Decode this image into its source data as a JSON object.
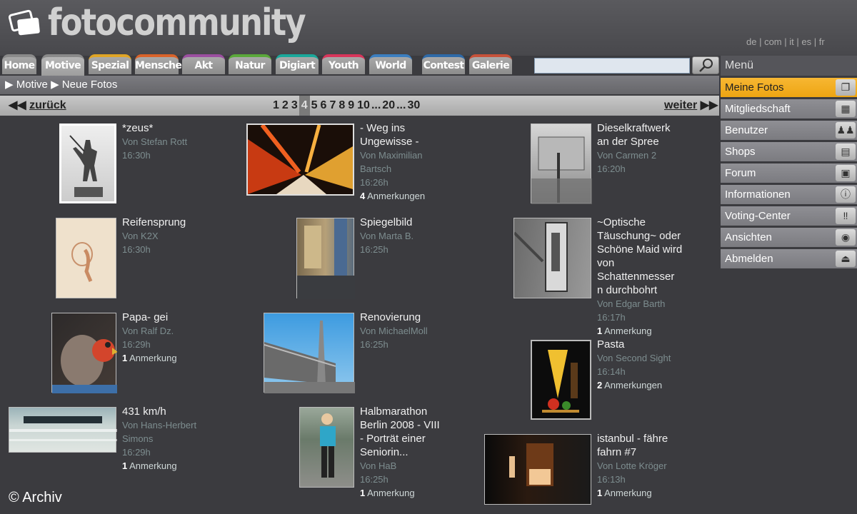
{
  "header": {
    "logo": "fotocommunity",
    "languages": [
      "de",
      "com",
      "it",
      "es",
      "fr"
    ],
    "lang_sep": " | "
  },
  "tabs": [
    "Home",
    "Motive",
    "Spezial",
    "Menschen",
    "Akt",
    "Natur",
    "Digiart",
    "Youth",
    "World",
    "Contest",
    "Galerie"
  ],
  "search": {
    "placeholder": "",
    "button_icon": "search-icon"
  },
  "breadcrumb": [
    "Motive",
    "Neue Fotos"
  ],
  "pager": {
    "prev": "zurück",
    "next": "weiter",
    "pages": [
      "1",
      "2",
      "3",
      "4",
      "5",
      "6",
      "7",
      "8",
      "9",
      "10",
      "...",
      "20",
      "...",
      "30"
    ],
    "current": "4"
  },
  "sidebar": {
    "title": "Menü",
    "items": [
      {
        "label": "Meine Fotos",
        "icon": "photos-icon"
      },
      {
        "label": "Mitgliedschaft",
        "icon": "calculator-icon"
      },
      {
        "label": "Benutzer",
        "icon": "users-icon"
      },
      {
        "label": "Shops",
        "icon": "cart-icon"
      },
      {
        "label": "Forum",
        "icon": "forum-icon"
      },
      {
        "label": "Informationen",
        "icon": "info-icon"
      },
      {
        "label": "Voting-Center",
        "icon": "exclamation-icon"
      },
      {
        "label": "Ansichten",
        "icon": "eye-icon"
      },
      {
        "label": "Abmelden",
        "icon": "eject-icon"
      }
    ]
  },
  "photos": [
    {
      "title": "*zeus*",
      "author": "Von Stefan Rott",
      "time": "16:30h",
      "notes": "",
      "notes_label": ""
    },
    {
      "title": "- Weg ins Ungewisse -",
      "author": "Von Maximilian Bartsch",
      "time": "16:26h",
      "notes": "4",
      "notes_label": " Anmerkungen"
    },
    {
      "title": "Dieselkraftwerk an der Spree",
      "author": "Von Carmen 2",
      "time": "16:20h",
      "notes": "",
      "notes_label": ""
    },
    {
      "title": "Reifensprung",
      "author": "Von K2X",
      "time": "16:30h",
      "notes": "",
      "notes_label": ""
    },
    {
      "title": "Spiegelbild",
      "author": "Von Marta B.",
      "time": "16:25h",
      "notes": "",
      "notes_label": ""
    },
    {
      "title": "~Optische Täuschung~ oder Schöne Maid wird von Schattenmesser n durchbohrt",
      "author": "Von Edgar Barth",
      "time": "16:17h",
      "notes": "1",
      "notes_label": " Anmerkung"
    },
    {
      "title": "Papa- gei",
      "author": "Von Ralf Dz.",
      "time": "16:29h",
      "notes": "1",
      "notes_label": " Anmerkung"
    },
    {
      "title": "Renovierung",
      "author": "Von MichaelMoll",
      "time": "16:25h",
      "notes": "",
      "notes_label": ""
    },
    {
      "title": "Pasta",
      "author": "Von Second Sight",
      "time": "16:14h",
      "notes": "2",
      "notes_label": " Anmerkungen"
    },
    {
      "title": "431 km/h",
      "author": "Von Hans-Herbert Simons",
      "time": "16:29h",
      "notes": "1",
      "notes_label": " Anmerkung"
    },
    {
      "title": "Halbmarathon Berlin 2008 - VIII - Porträt einer Seniorin...",
      "author": "Von HaB",
      "time": "16:25h",
      "notes": "1",
      "notes_label": " Anmerkung"
    },
    {
      "title": "istanbul - fähre fahrn #7",
      "author": "Von Lotte Kröger",
      "time": "16:13h",
      "notes": "1",
      "notes_label": " Anmerkung"
    }
  ],
  "copyright": "© Archiv",
  "colors": {
    "tab_borders": [
      "#8a8a8a",
      "#8a8a8a",
      "#e0a526",
      "#d9632a",
      "#9b4fa0",
      "#5aa83a",
      "#1aa89a",
      "#d8355b",
      "#3b7ec0",
      "#2e6aa8",
      "#c7523a"
    ],
    "active_menu": "#f4b02a"
  }
}
